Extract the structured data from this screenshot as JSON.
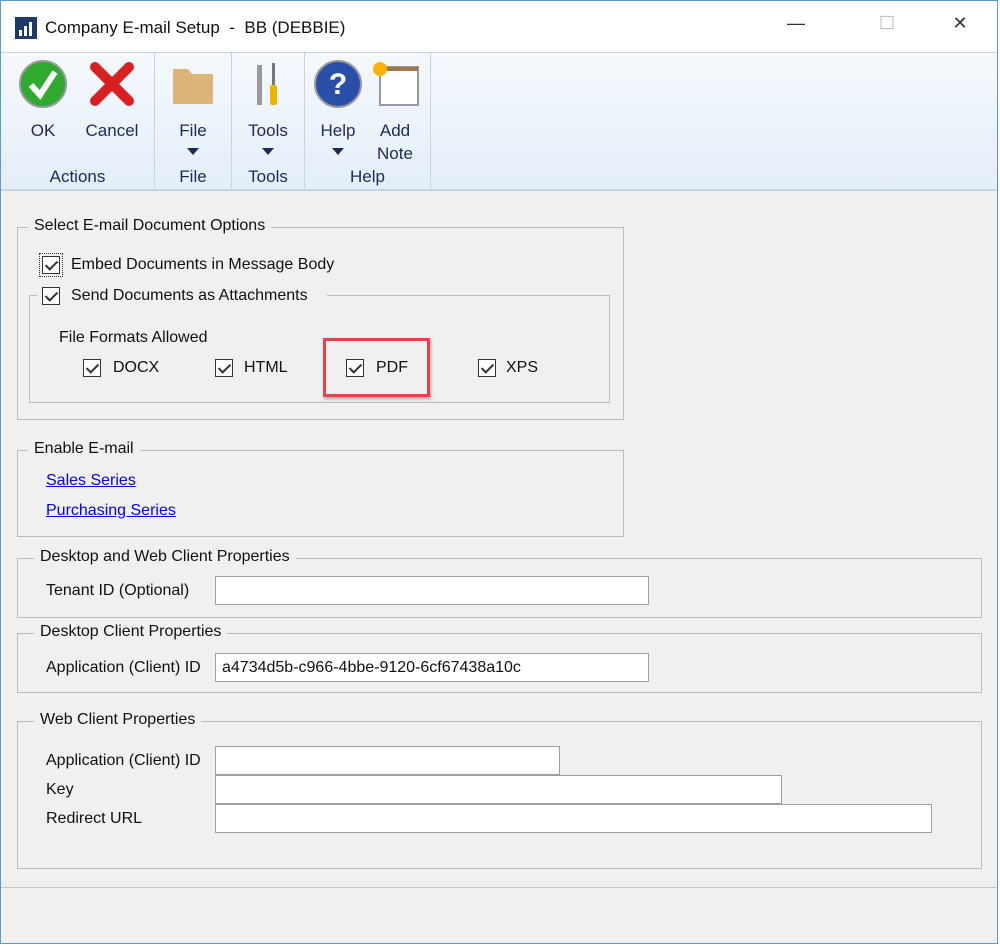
{
  "window": {
    "title": "Company E-mail Setup  -  BB (DEBBIE)",
    "minimize": "—",
    "maximize": "☐",
    "close": "✕"
  },
  "ribbon": {
    "groups": [
      {
        "label": "Actions",
        "buttons": [
          {
            "label": "OK",
            "icon": "ok-check-icon"
          },
          {
            "label": "Cancel",
            "icon": "cancel-x-icon"
          }
        ]
      },
      {
        "label": "File",
        "buttons": [
          {
            "label": "File",
            "icon": "folder-icon"
          }
        ]
      },
      {
        "label": "Tools",
        "buttons": [
          {
            "label": "Tools",
            "icon": "tools-icon"
          }
        ]
      },
      {
        "label": "Help",
        "buttons": [
          {
            "label": "Help",
            "icon": "help-icon"
          },
          {
            "label": "Add Note",
            "icon": "add-note-icon"
          }
        ]
      }
    ]
  },
  "email_options": {
    "legend": "Select E-mail Document Options",
    "embed": {
      "label": "Embed Documents in Message Body",
      "checked": true
    },
    "attach": {
      "label": "Send Documents as Attachments",
      "checked": true
    },
    "formats_label": "File Formats Allowed",
    "formats": [
      {
        "label": "DOCX",
        "checked": true
      },
      {
        "label": "HTML",
        "checked": true
      },
      {
        "label": "PDF",
        "checked": true
      },
      {
        "label": "XPS",
        "checked": true
      }
    ],
    "highlight_color": "#e8424a"
  },
  "enable_email": {
    "legend": "Enable E-mail",
    "links": [
      "Sales Series",
      "Purchasing Series"
    ]
  },
  "desktop_web": {
    "legend": "Desktop and Web Client Properties",
    "tenant_label": "Tenant ID (Optional)",
    "tenant_value": ""
  },
  "desktop": {
    "legend": "Desktop Client Properties",
    "app_id_label": "Application (Client) ID",
    "app_id_value": "a4734d5b-c966-4bbe-9120-6cf67438a10c"
  },
  "web": {
    "legend": "Web Client Properties",
    "app_id_label": "Application (Client) ID",
    "app_id_value": "",
    "key_label": "Key",
    "key_value": "",
    "redirect_label": "Redirect URL",
    "redirect_value": ""
  }
}
